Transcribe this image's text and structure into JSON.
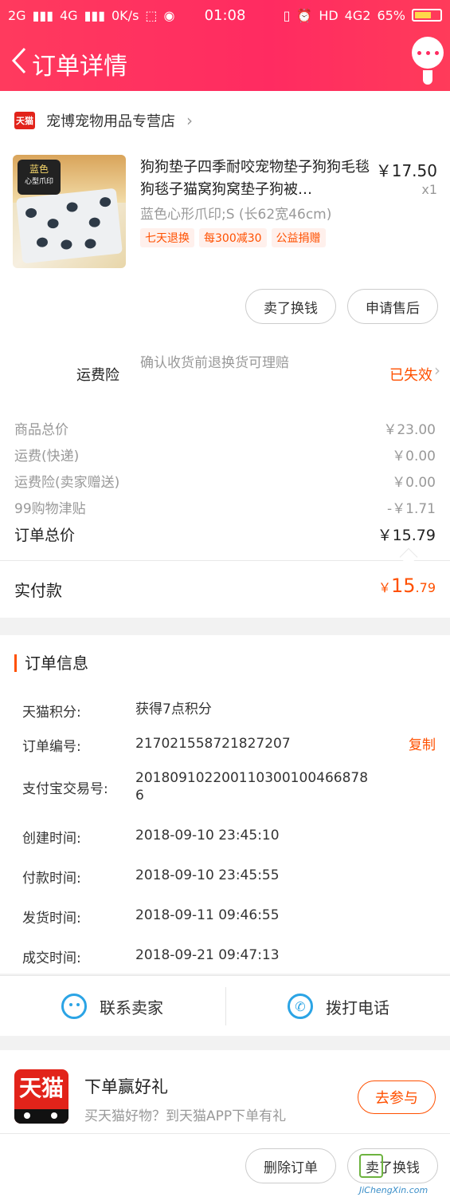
{
  "status_bar": {
    "left": [
      "2G",
      "4G",
      "0K/s"
    ],
    "time": "01:08",
    "right": [
      "HD",
      "4G2",
      "65%"
    ],
    "battery_level": 0.65
  },
  "header": {
    "title": "订单详情"
  },
  "shop": {
    "tag": "天猫",
    "name": "宠博宠物用品专营店"
  },
  "product": {
    "image_badge": "蓝色",
    "image_badge_sub": "心型爪印",
    "title": "狗狗垫子四季耐咬宠物垫子狗狗毛毯狗毯子猫窝狗窝垫子狗被…",
    "price": "￥17.50",
    "qty": "x1",
    "sku": "蓝色心形爪印;S (长62宽46cm)",
    "tags": [
      "七天退换",
      "每300减30",
      "公益捐赠"
    ]
  },
  "actions": {
    "sell": "卖了换钱",
    "after_sale": "申请售后"
  },
  "insurance": {
    "label": "运费险",
    "desc": "确认收货前退换货可理赔",
    "status": "已失效"
  },
  "fees": [
    {
      "label": "商品总价",
      "value": "￥23.00"
    },
    {
      "label": "运费(快递)",
      "value": "￥0.00"
    },
    {
      "label": "运费险(卖家赠送)",
      "value": "￥0.00"
    },
    {
      "label": "99购物津贴",
      "value": "-￥1.71"
    }
  ],
  "total": {
    "label": "订单总价",
    "value": "￥15.79"
  },
  "paid": {
    "label": "实付款",
    "currency": "￥",
    "int": "15",
    "dec": ".79"
  },
  "order_info": {
    "title": "订单信息",
    "copy": "复制",
    "rows": [
      {
        "k": "天猫积分:",
        "v": "获得7点积分"
      },
      {
        "k": "订单编号:",
        "v": "217021558721827207"
      },
      {
        "k": "支付宝交易号:",
        "v": "2018091022001103001004668786"
      },
      {
        "k": "创建时间:",
        "v": "2018-09-10 23:45:10"
      },
      {
        "k": "付款时间:",
        "v": "2018-09-10 23:45:55"
      },
      {
        "k": "发货时间:",
        "v": "2018-09-11 09:46:55"
      },
      {
        "k": "成交时间:",
        "v": "2018-09-21 09:47:13"
      }
    ]
  },
  "contact": {
    "seller": "联系卖家",
    "phone": "拨打电话"
  },
  "promo": {
    "logo": "天猫",
    "title": "下单赢好礼",
    "sub": "买天猫好物？到天猫APP下单有礼",
    "join": "去参与"
  },
  "bottom": {
    "delete": "删除订单",
    "sell": "卖了换钱"
  },
  "watermark": {
    "url": "JiChengXin.com"
  },
  "colors": {
    "brand_gradient": "#ff2b61",
    "accent": "#ff5000",
    "link_blue": "#2ba4e5"
  }
}
